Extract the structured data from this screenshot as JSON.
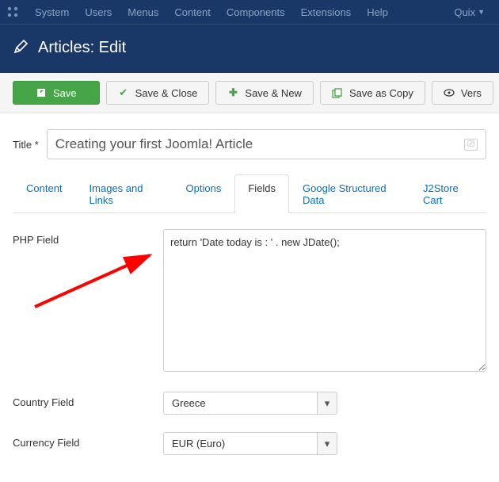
{
  "topbar": {
    "items": [
      "System",
      "Users",
      "Menus",
      "Content",
      "Components",
      "Extensions",
      "Help"
    ],
    "quix": "Quix"
  },
  "header": {
    "title": "Articles: Edit"
  },
  "toolbar": {
    "save": "Save",
    "save_close": "Save & Close",
    "save_new": "Save & New",
    "save_copy": "Save as Copy",
    "versions": "Vers"
  },
  "title_field": {
    "label": "Title *",
    "value": "Creating your first Joomla! Article"
  },
  "tabs": [
    "Content",
    "Images and Links",
    "Options",
    "Fields",
    "Google Structured Data",
    "J2Store Cart"
  ],
  "active_tab": "Fields",
  "fields": {
    "php": {
      "label": "PHP Field",
      "value": "return 'Date today is : ' . new JDate();"
    },
    "country": {
      "label": "Country Field",
      "value": "Greece"
    },
    "currency": {
      "label": "Currency Field",
      "value": "EUR (Euro)"
    }
  }
}
